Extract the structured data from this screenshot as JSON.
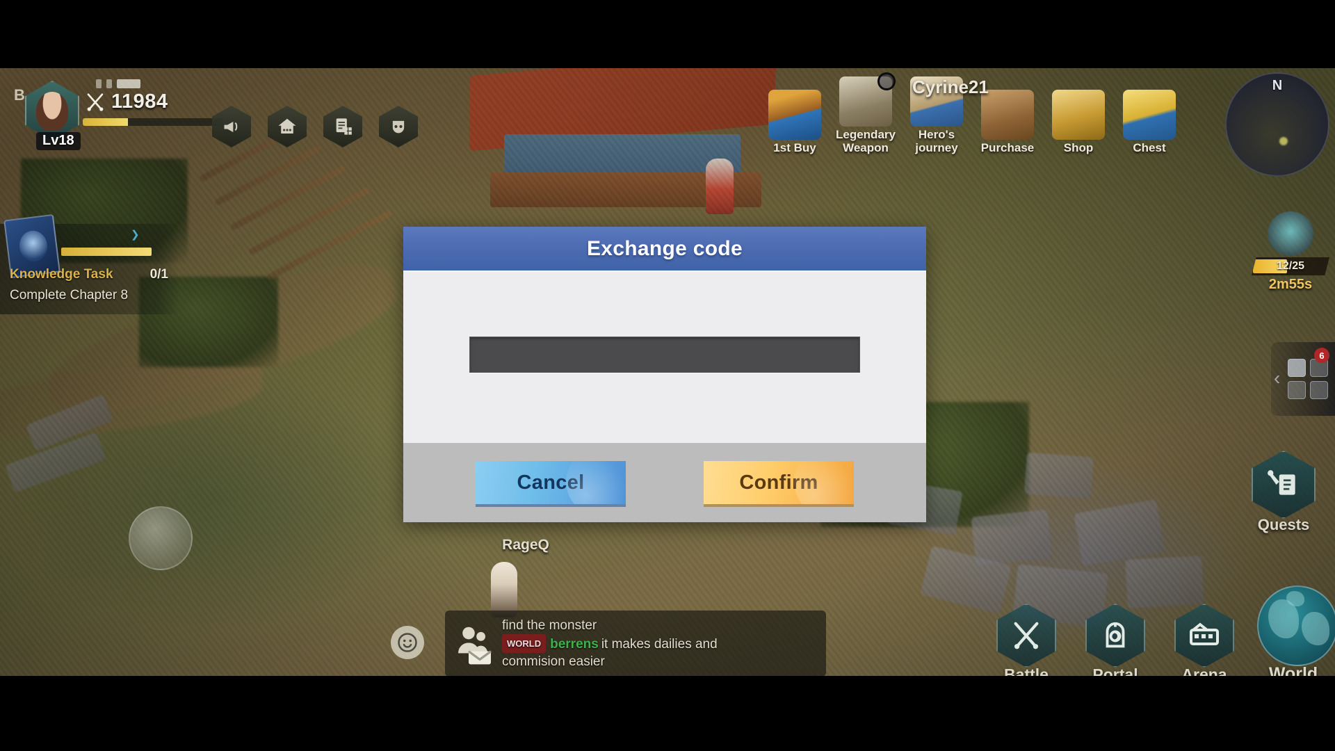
{
  "dialog": {
    "title": "Exchange code",
    "input_value": "",
    "input_placeholder": "",
    "cancel_label": "Cancel",
    "confirm_label": "Confirm",
    "header_color": "#4e6cb2",
    "body_color": "#ededf0",
    "footer_color": "#bcbcbc",
    "input_color": "#4b4b4e",
    "cancel_color": "#6fbdea",
    "confirm_color": "#ffce6c"
  },
  "hud": {
    "letter": "B",
    "level": "Lv18",
    "power": "11984",
    "power_icon": "crossed-swords-icon"
  },
  "toolbar": {
    "items": [
      {
        "name": "announcement-icon",
        "label": "Announcement"
      },
      {
        "name": "guild-home-icon",
        "label": "Guild"
      },
      {
        "name": "task-list-icon",
        "label": "Tasks"
      },
      {
        "name": "mask-icon",
        "label": "Mask"
      }
    ]
  },
  "quest": {
    "panel_title": "Knowledge Task",
    "count": "0/1",
    "subtitle": "Complete Chapter 8",
    "bar_percent": 100
  },
  "shop_rail": {
    "items": [
      {
        "label": "1st Buy",
        "icon": "first-buy-icon"
      },
      {
        "label": "Legendary\nWeapon",
        "label_line1": "Legendary",
        "label_line2": "Weapon",
        "icon": "legendary-weapon-icon"
      },
      {
        "label": "Hero's\njourney",
        "label_line1": "Hero's",
        "label_line2": "journey",
        "icon": "heros-journey-icon"
      },
      {
        "label": "Purchase",
        "icon": "purchase-icon"
      },
      {
        "label": "Shop",
        "icon": "shop-icon"
      },
      {
        "label": "Chest",
        "icon": "chest-icon"
      }
    ]
  },
  "player": {
    "nearby_name": "Cyrine21",
    "field_name": "RageQ"
  },
  "minimap": {
    "compass": "N"
  },
  "event_widget": {
    "progress_text": "12/25",
    "timer": "2m55s",
    "progress_percent": 48
  },
  "side_menu": {
    "badge": "6",
    "chevron": "‹"
  },
  "quests_button": {
    "label": "Quests",
    "icon": "quest-scroll-icon"
  },
  "bottom_nav": {
    "items": [
      {
        "label": "Battle",
        "icon": "crossed-swords-icon"
      },
      {
        "label": "Portal",
        "icon": "portal-icon"
      },
      {
        "label": "Arena",
        "icon": "arena-icon"
      },
      {
        "label": "World",
        "icon": "globe-icon"
      }
    ]
  },
  "chat": {
    "line1": "find the monster",
    "channel": "WORLD",
    "username": "berrens",
    "line2a": "it makes dailies and",
    "line2b": "commision easier",
    "emoji_icon": "smiley-icon",
    "avatar_icon": "chat-people-icon"
  }
}
